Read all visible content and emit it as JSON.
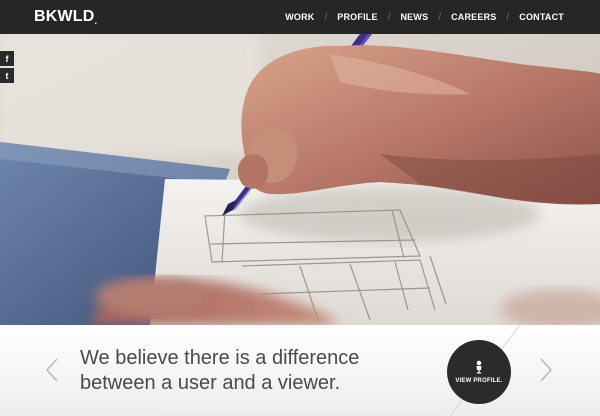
{
  "header": {
    "logo": "BKWLD",
    "logo_dot": ".",
    "nav": [
      "WORK",
      "PROFILE",
      "NEWS",
      "CAREERS",
      "CONTACT"
    ],
    "nav_separator": "/"
  },
  "social": {
    "items": [
      {
        "glyph": "f",
        "icon": "facebook-icon"
      },
      {
        "glyph": "t",
        "icon": "twitter-icon"
      }
    ]
  },
  "hero": {
    "image": "hand-sketching-wireframe-photo"
  },
  "band": {
    "tagline_line1": "We believe there is a difference",
    "tagline_line2": "between a user and a viewer.",
    "profile_button": "VIEW PROFILE.",
    "profile_icon": "microphone-person-icon",
    "prev_icon": "chevron-left-icon",
    "next_icon": "chevron-right-icon"
  },
  "colors": {
    "header_bg": "#262626",
    "tagline": "#4a4a4a",
    "profile_button_bg": "#2b2b2b",
    "pen": "#3b2f86"
  }
}
